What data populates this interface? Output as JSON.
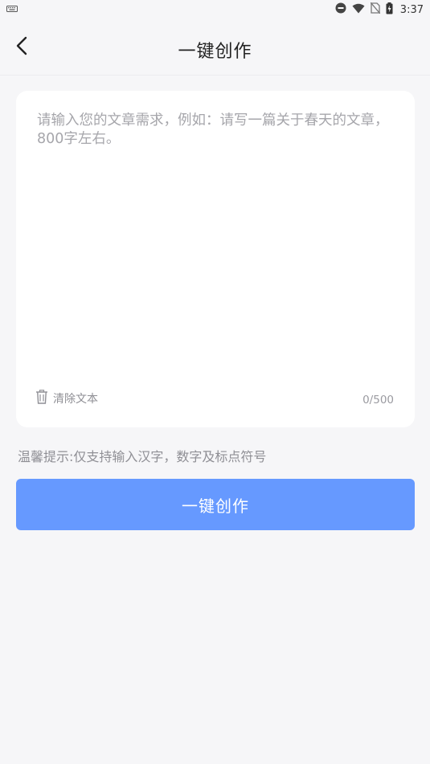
{
  "statusbar": {
    "time": "3:37",
    "icons": [
      "keyboard-icon",
      "do-not-disturb-icon",
      "wifi-icon",
      "no-sim-icon",
      "battery-charging-icon"
    ]
  },
  "header": {
    "title": "一键创作",
    "back_icon": "chevron-left-icon"
  },
  "editor": {
    "placeholder": "请输入您的文章需求，例如：请写一篇关于春天的文章，800字左右。",
    "value": "",
    "clear_label": "清除文本",
    "clear_icon": "trash-icon",
    "char_count": "0/500"
  },
  "tip": "温馨提示:仅支持输入汉字，数字及标点符号",
  "action": {
    "create_label": "一键创作"
  },
  "colors": {
    "accent": "#6699ff",
    "background": "#f6f6f8",
    "card": "#ffffff"
  }
}
